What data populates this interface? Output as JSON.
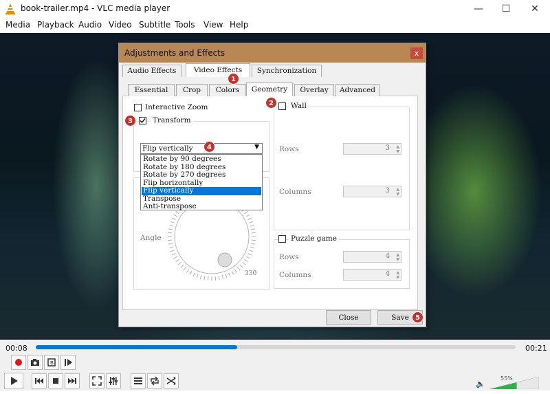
{
  "window": {
    "title": "book-trailer.mp4 - VLC media player",
    "minimize": "—",
    "maximize": "☐",
    "close": "✕"
  },
  "menu": [
    "Media",
    "Playback",
    "Audio",
    "Video",
    "Subtitle",
    "Tools",
    "View",
    "Help"
  ],
  "dialog": {
    "title": "Adjustments and Effects",
    "close": "x",
    "main_tabs": [
      "Audio Effects",
      "Video Effects",
      "Synchronization"
    ],
    "selected_main_tab": "Video Effects",
    "sub_tabs": [
      "Essential",
      "Crop",
      "Colors",
      "Geometry",
      "Overlay",
      "Advanced"
    ],
    "selected_sub_tab": "Geometry",
    "interactive_zoom": {
      "label": "Interactive Zoom",
      "checked": false
    },
    "transform": {
      "label": "Transform",
      "checked": true,
      "selected": "Flip vertically",
      "options": [
        "Rotate by 90 degrees",
        "Rotate by 180 degrees",
        "Rotate by 270 degrees",
        "Flip horizontally",
        "Flip vertically",
        "Transpose",
        "Anti-transpose"
      ]
    },
    "angle": {
      "label": "Angle",
      "value_label": "330"
    },
    "wall": {
      "label": "Wall",
      "checked": false,
      "rows_label": "Rows",
      "rows": "3",
      "columns_label": "Columns",
      "columns": "3"
    },
    "puzzle": {
      "label": "Puzzle game",
      "checked": false,
      "rows_label": "Rows",
      "rows": "4",
      "columns_label": "Columns",
      "columns": "4"
    },
    "buttons": {
      "close": "Close",
      "save": "Save"
    },
    "badges": [
      "1",
      "2",
      "3",
      "4",
      "5"
    ]
  },
  "player": {
    "elapsed": "00:08",
    "duration": "00:21",
    "progress_fraction": 0.42,
    "volume_label": "55%",
    "volume_fraction": 0.55,
    "accent": "#0078d7"
  }
}
